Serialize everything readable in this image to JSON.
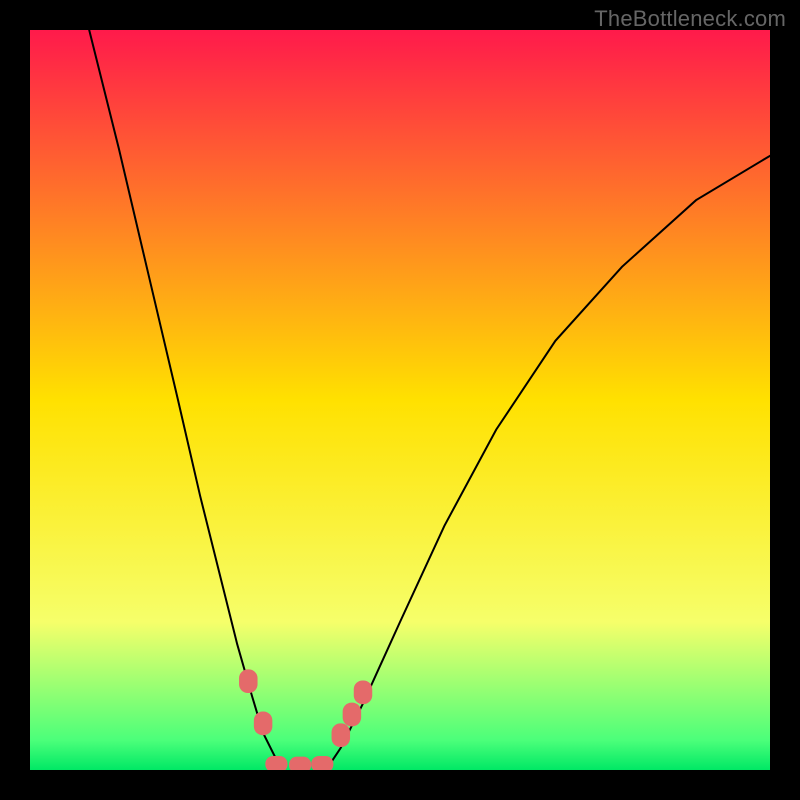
{
  "watermark": "TheBottleneck.com",
  "chart_data": {
    "type": "line",
    "title": "",
    "xlabel": "",
    "ylabel": "",
    "xlim": [
      0,
      100
    ],
    "ylim": [
      0,
      100
    ],
    "grid": false,
    "legend": false,
    "background_gradient": {
      "stops": [
        {
          "offset": 0,
          "color": "#ff1a4b"
        },
        {
          "offset": 50,
          "color": "#ffe100"
        },
        {
          "offset": 80,
          "color": "#f6ff6a"
        },
        {
          "offset": 96,
          "color": "#4bff7a"
        },
        {
          "offset": 100,
          "color": "#00e865"
        }
      ]
    },
    "series": [
      {
        "name": "left-branch",
        "type": "line",
        "color": "#000000",
        "width": 2,
        "x": [
          8,
          12,
          16,
          20,
          23,
          26,
          28,
          30,
          31.5,
          33,
          34
        ],
        "y": [
          100,
          84,
          67,
          50,
          37,
          25,
          17,
          10,
          5,
          2,
          0
        ]
      },
      {
        "name": "right-branch",
        "type": "line",
        "color": "#000000",
        "width": 2,
        "x": [
          40,
          42,
          45,
          50,
          56,
          63,
          71,
          80,
          90,
          100
        ],
        "y": [
          0,
          3,
          9,
          20,
          33,
          46,
          58,
          68,
          77,
          83
        ]
      },
      {
        "name": "floor",
        "type": "line",
        "color": "#00e865",
        "width": 0,
        "x": [
          34,
          40
        ],
        "y": [
          0,
          0
        ]
      },
      {
        "name": "pink-markers-left",
        "type": "scatter",
        "color": "#e46a6a",
        "marker_width": 2.5,
        "marker_height": 3.2,
        "x": [
          29.5,
          31.5
        ],
        "y": [
          12,
          6.3
        ]
      },
      {
        "name": "pink-markers-bottom",
        "type": "scatter",
        "color": "#e46a6a",
        "marker_width": 3.0,
        "marker_height": 2.2,
        "x": [
          33.3,
          36.5,
          39.5
        ],
        "y": [
          0.8,
          0.7,
          0.8
        ]
      },
      {
        "name": "pink-markers-right",
        "type": "scatter",
        "color": "#e46a6a",
        "marker_width": 2.5,
        "marker_height": 3.2,
        "x": [
          42,
          43.5,
          45
        ],
        "y": [
          4.7,
          7.5,
          10.5
        ]
      }
    ]
  }
}
